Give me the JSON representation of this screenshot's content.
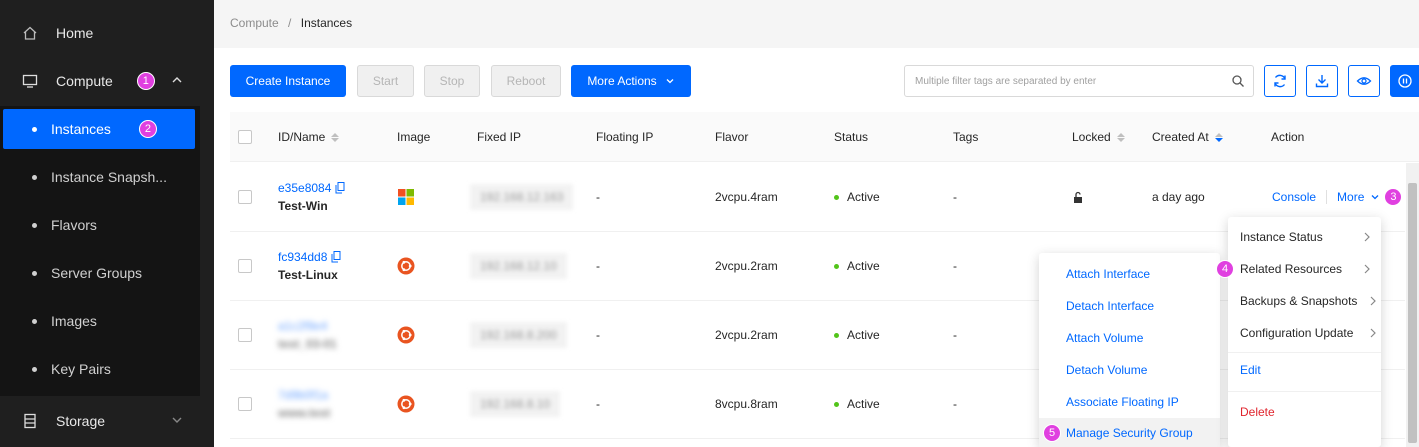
{
  "sidebar": {
    "home": "Home",
    "compute": "Compute",
    "compute_badge": "1",
    "items": [
      {
        "label": "Instances",
        "badge": "2"
      },
      {
        "label": "Instance Snapsh..."
      },
      {
        "label": "Flavors"
      },
      {
        "label": "Server Groups"
      },
      {
        "label": "Images"
      },
      {
        "label": "Key Pairs"
      }
    ],
    "storage": "Storage"
  },
  "breadcrumb": {
    "parent": "Compute",
    "sep": "/",
    "current": "Instances"
  },
  "toolbar": {
    "create": "Create Instance",
    "start": "Start",
    "stop": "Stop",
    "reboot": "Reboot",
    "more_actions": "More Actions",
    "search_placeholder": "Multiple filter tags are separated by enter"
  },
  "table": {
    "headers": {
      "idname": "ID/Name",
      "image": "Image",
      "fixed_ip": "Fixed IP",
      "floating_ip": "Floating IP",
      "flavor": "Flavor",
      "status": "Status",
      "tags": "Tags",
      "locked": "Locked",
      "created_at": "Created At",
      "action": "Action"
    },
    "rows": [
      {
        "id": "e35e8084",
        "name": "Test-Win",
        "image": "windows",
        "fixed_ip": "192.168.12.163",
        "floating_ip": "-",
        "flavor": "2vcpu.4ram",
        "status": "Active",
        "tags": "-",
        "created": "a day ago"
      },
      {
        "id": "fc934dd8",
        "name": "Test-Linux",
        "image": "ubuntu",
        "fixed_ip": "192.168.12.10",
        "floating_ip": "-",
        "flavor": "2vcpu.2ram",
        "status": "Active",
        "tags": "-"
      },
      {
        "id": "a1c2f9e4",
        "name": "test_03-01",
        "image": "ubuntu",
        "fixed_ip": "192.168.8.200",
        "floating_ip": "-",
        "flavor": "2vcpu.2ram",
        "status": "Active",
        "tags": "-"
      },
      {
        "id": "7d9b0f1a",
        "name": "www.test",
        "image": "ubuntu",
        "fixed_ip": "192.168.8.10",
        "floating_ip": "-",
        "flavor": "8vcpu.8ram",
        "status": "Active",
        "tags": "-"
      }
    ],
    "console": "Console",
    "more": "More",
    "more_badge": "3"
  },
  "more_menu": {
    "items": [
      "Instance Status",
      "Related Resources",
      "Backups & Snapshots",
      "Configuration Update",
      "Edit",
      "Delete"
    ],
    "related_badge": "4"
  },
  "related_menu": {
    "items": [
      "Attach Interface",
      "Detach Interface",
      "Attach Volume",
      "Detach Volume",
      "Associate Floating IP",
      "Manage Security Group"
    ],
    "security_badge": "5"
  },
  "colors": {
    "accent": "#0068ff",
    "badge": "#e040e0",
    "active": "#52c41a",
    "danger": "#e0242d"
  }
}
